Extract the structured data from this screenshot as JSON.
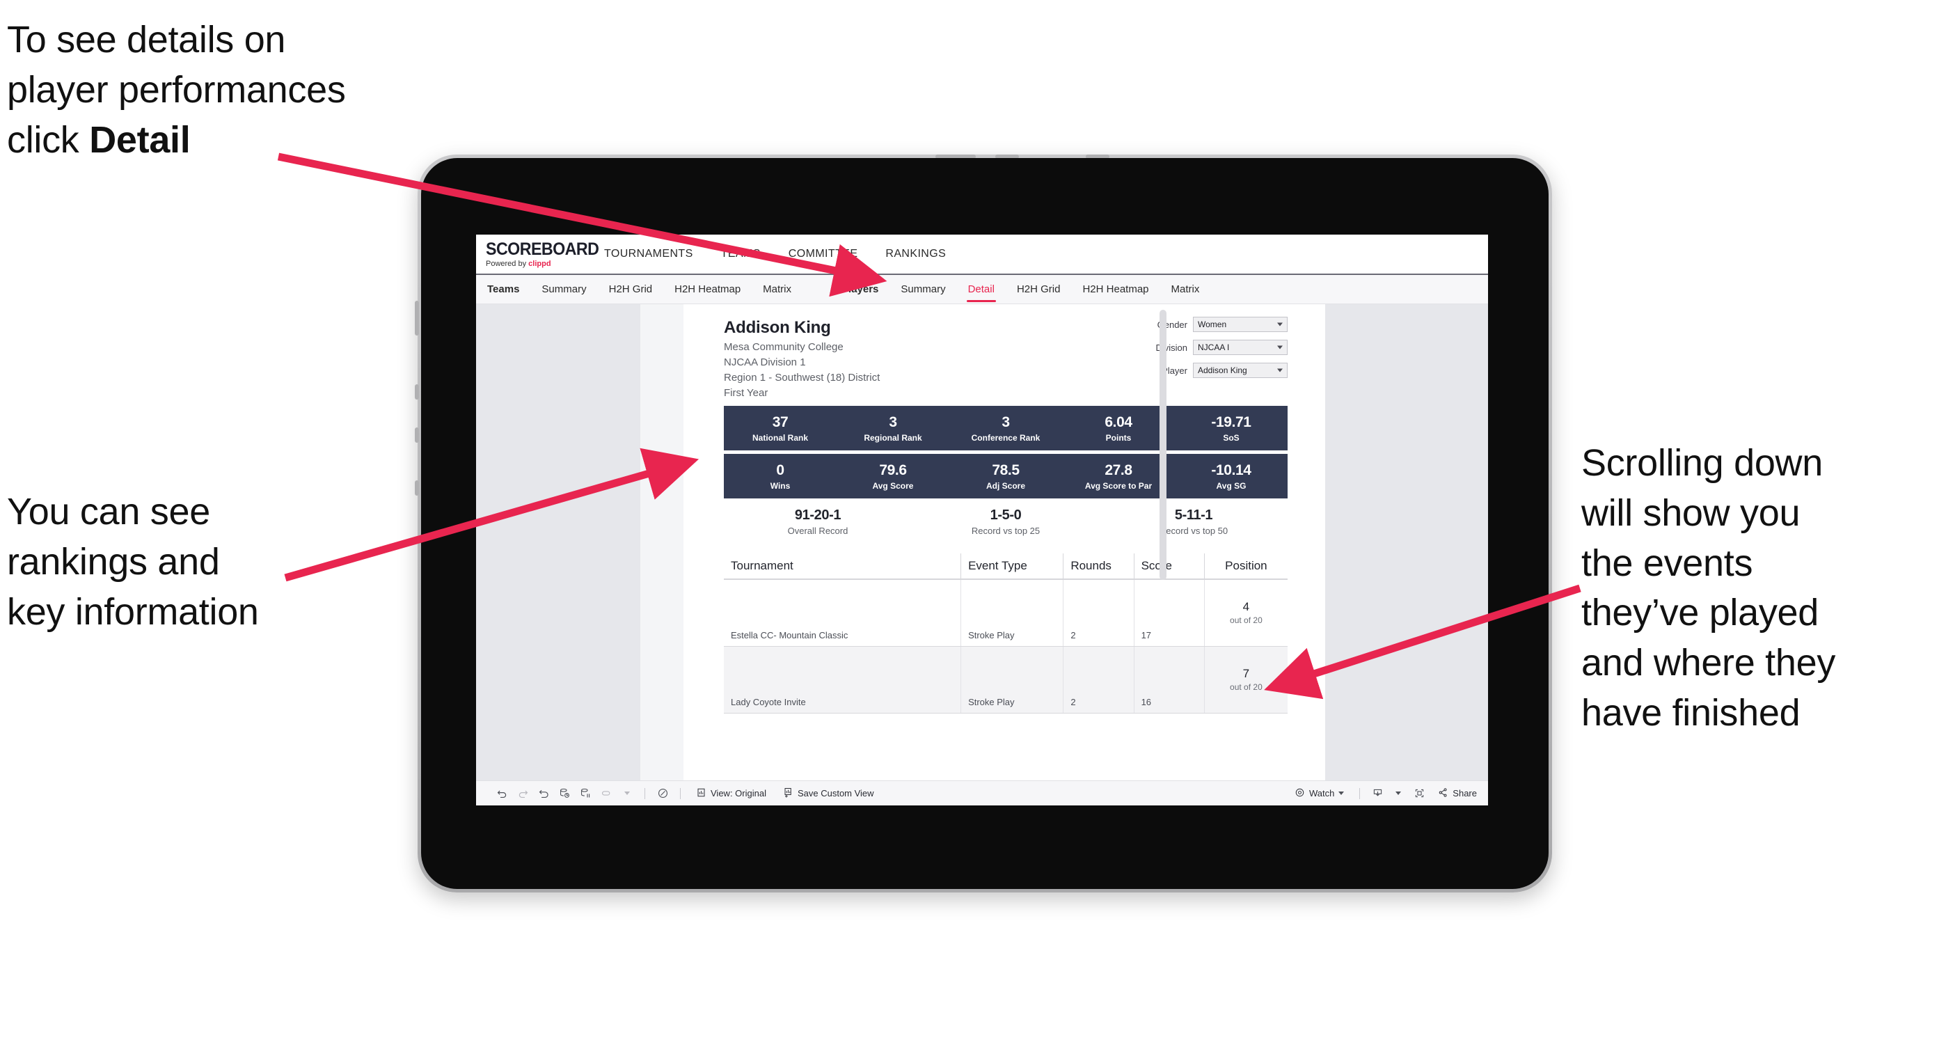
{
  "annotations": {
    "detail": {
      "line1": "To see details on",
      "line2": "player performances",
      "line3_pre": "click ",
      "line3_bold": "Detail"
    },
    "ranking": {
      "line1": "You can see",
      "line2": "rankings and",
      "line3": "key information"
    },
    "scrolling": {
      "line1": "Scrolling down",
      "line2": "will show you",
      "line3": "the events",
      "line4": "they’ve played",
      "line5": "and where they",
      "line6": "have finished"
    }
  },
  "colors": {
    "accent_pink": "#E8254F",
    "kpi_navy": "#333B54",
    "tablet_body": "#0C0C0C"
  },
  "app": {
    "brand": {
      "title": "SCOREBOARD",
      "powered_prefix": "Powered by ",
      "powered_name": "clippd"
    },
    "top_nav": [
      {
        "label": "TOURNAMENTS"
      },
      {
        "label": "TEAMS"
      },
      {
        "label": "COMMITTEE"
      },
      {
        "label": "RANKINGS"
      }
    ],
    "sub_nav": {
      "group_teams": [
        {
          "label": "Teams",
          "lead": true,
          "active": false
        },
        {
          "label": "Summary",
          "active": false
        },
        {
          "label": "H2H Grid",
          "active": false
        },
        {
          "label": "H2H Heatmap",
          "active": false
        },
        {
          "label": "Matrix",
          "active": false
        }
      ],
      "group_players": [
        {
          "label": "Players",
          "lead": true,
          "active": false
        },
        {
          "label": "Summary",
          "active": false
        },
        {
          "label": "Detail",
          "active": true
        },
        {
          "label": "H2H Grid",
          "active": false
        },
        {
          "label": "H2H Heatmap",
          "active": false
        },
        {
          "label": "Matrix",
          "active": false
        }
      ]
    },
    "player": {
      "name": "Addison King",
      "school": "Mesa Community College",
      "division": "NJCAA Division 1",
      "region": "Region 1 - Southwest (18) District",
      "class_year": "First Year"
    },
    "filters": [
      {
        "label": "Gender",
        "value": "Women"
      },
      {
        "label": "Division",
        "value": "NJCAA I"
      },
      {
        "label": "Player",
        "value": "Addison King"
      }
    ],
    "kpi_row_1": [
      {
        "value": "37",
        "label": "National Rank"
      },
      {
        "value": "3",
        "label": "Regional Rank"
      },
      {
        "value": "3",
        "label": "Conference Rank"
      },
      {
        "value": "6.04",
        "label": "Points"
      },
      {
        "value": "-19.71",
        "label": "SoS"
      }
    ],
    "kpi_row_2": [
      {
        "value": "0",
        "label": "Wins"
      },
      {
        "value": "79.6",
        "label": "Avg Score"
      },
      {
        "value": "78.5",
        "label": "Adj Score"
      },
      {
        "value": "27.8",
        "label": "Avg Score to Par"
      },
      {
        "value": "-10.14",
        "label": "Avg SG"
      }
    ],
    "records": [
      {
        "value": "91-20-1",
        "label": "Overall Record"
      },
      {
        "value": "1-5-0",
        "label": "Record vs top 25"
      },
      {
        "value": "5-11-1",
        "label": "Record vs top 50"
      }
    ],
    "events_table": {
      "columns": [
        "Tournament",
        "Event Type",
        "Rounds",
        "Score",
        "Position"
      ],
      "rows": [
        {
          "tournament": "Estella CC- Mountain Classic",
          "event_type": "Stroke Play",
          "rounds": "2",
          "score": "17",
          "position": "4",
          "position_sub": "out of 20"
        },
        {
          "tournament": "Lady Coyote Invite",
          "event_type": "Stroke Play",
          "rounds": "2",
          "score": "16",
          "position": "7",
          "position_sub": "out of 20"
        }
      ]
    },
    "toolbar": {
      "icons": [
        "undo-icon",
        "redo-icon",
        "revert-icon",
        "refresh-data-icon",
        "pause-updates-icon",
        "custom-views-icon"
      ],
      "view_label": "View: Original",
      "save_label": "Save Custom View",
      "watch_label": "Watch",
      "share_label": "Share"
    }
  }
}
